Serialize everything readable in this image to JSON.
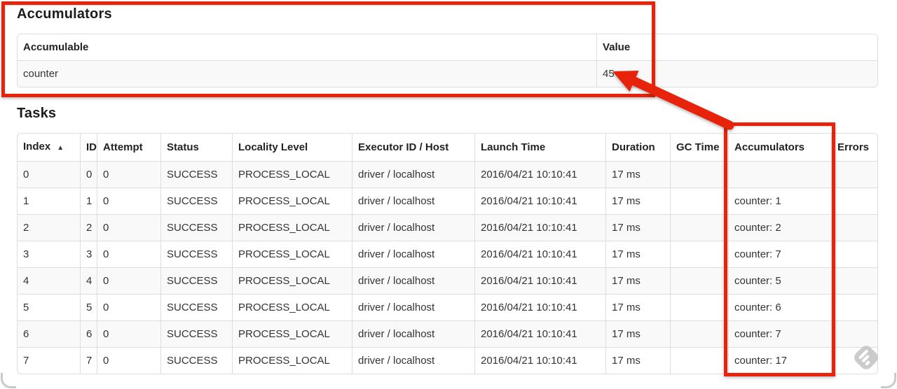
{
  "theme": {
    "annotation_red": "#e8230b",
    "stripe_gray": "#f9f9f9",
    "table_border": "#dddddd",
    "text_color": "#333333"
  },
  "accumulators_section": {
    "title": "Accumulators",
    "columns": [
      "Accumulable",
      "Value"
    ],
    "rows": [
      [
        "counter",
        "45"
      ]
    ]
  },
  "tasks_section": {
    "title": "Tasks",
    "sort_indicator": "▲",
    "columns": [
      "Index",
      "ID",
      "Attempt",
      "Status",
      "Locality Level",
      "Executor ID / Host",
      "Launch Time",
      "Duration",
      "GC Time",
      "Accumulators",
      "Errors"
    ],
    "rows": [
      [
        "0",
        "0",
        "0",
        "SUCCESS",
        "PROCESS_LOCAL",
        "driver / localhost",
        "2016/04/21 10:10:41",
        "17 ms",
        "",
        "",
        ""
      ],
      [
        "1",
        "1",
        "0",
        "SUCCESS",
        "PROCESS_LOCAL",
        "driver / localhost",
        "2016/04/21 10:10:41",
        "17 ms",
        "",
        "counter: 1",
        ""
      ],
      [
        "2",
        "2",
        "0",
        "SUCCESS",
        "PROCESS_LOCAL",
        "driver / localhost",
        "2016/04/21 10:10:41",
        "17 ms",
        "",
        "counter: 2",
        ""
      ],
      [
        "3",
        "3",
        "0",
        "SUCCESS",
        "PROCESS_LOCAL",
        "driver / localhost",
        "2016/04/21 10:10:41",
        "17 ms",
        "",
        "counter: 7",
        ""
      ],
      [
        "4",
        "4",
        "0",
        "SUCCESS",
        "PROCESS_LOCAL",
        "driver / localhost",
        "2016/04/21 10:10:41",
        "17 ms",
        "",
        "counter: 5",
        ""
      ],
      [
        "5",
        "5",
        "0",
        "SUCCESS",
        "PROCESS_LOCAL",
        "driver / localhost",
        "2016/04/21 10:10:41",
        "17 ms",
        "",
        "counter: 6",
        ""
      ],
      [
        "6",
        "6",
        "0",
        "SUCCESS",
        "PROCESS_LOCAL",
        "driver / localhost",
        "2016/04/21 10:10:41",
        "17 ms",
        "",
        "counter: 7",
        ""
      ],
      [
        "7",
        "7",
        "0",
        "SUCCESS",
        "PROCESS_LOCAL",
        "driver / localhost",
        "2016/04/21 10:10:41",
        "17 ms",
        "",
        "counter: 17",
        ""
      ]
    ]
  },
  "icons": {
    "sort_ascending": "▲",
    "watermark": "annotation-app-watermark"
  }
}
